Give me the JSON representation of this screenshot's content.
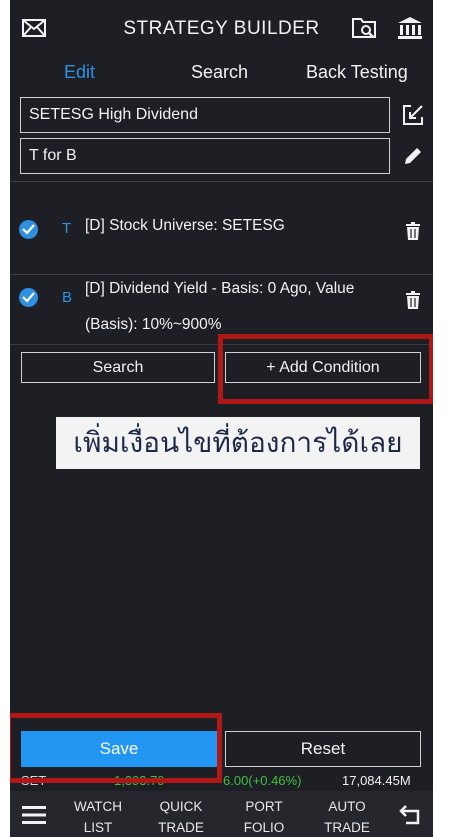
{
  "header": {
    "title": "STRATEGY BUILDER",
    "icons": [
      "mail-icon",
      "folder-search-icon",
      "bank-icon"
    ]
  },
  "tabs": [
    {
      "label": "Edit",
      "active": true
    },
    {
      "label": "Search",
      "active": false
    },
    {
      "label": "Back Testing",
      "active": false
    }
  ],
  "form": {
    "name_value": "SETESG High Dividend",
    "description_value": "T for B"
  },
  "conditions": [
    {
      "tag": "T",
      "text": "[D] Stock Universe: SETESG",
      "checked": true
    },
    {
      "tag": "B",
      "text": "[D] Dividend Yield - Basis: 0  Ago, Value (Basis): 10%~900%",
      "checked": true
    }
  ],
  "actions": {
    "search_label": "Search",
    "add_condition_label": "+ Add Condition"
  },
  "annotation": {
    "thai_text": "เพิ่มเงื่อนไขที่ต้องการได้เลย",
    "highlight_color": "#b01818"
  },
  "footer_buttons": {
    "save_label": "Save",
    "reset_label": "Reset"
  },
  "ticker": {
    "label": "SET",
    "value": "1,393.79",
    "change": "6.00(+0.46%)",
    "volume": "17,084.45M"
  },
  "bottom_nav": [
    {
      "line1": "WATCH",
      "line2": "LIST"
    },
    {
      "line1": "QUICK",
      "line2": "TRADE"
    },
    {
      "line1": "PORT",
      "line2": "FOLIO"
    },
    {
      "line1": "AUTO",
      "line2": "TRADE"
    }
  ],
  "colors": {
    "background": "#1e1f25",
    "accent": "#2f8fe0",
    "save_button": "#2196f3",
    "positive": "#3fbf3f"
  }
}
